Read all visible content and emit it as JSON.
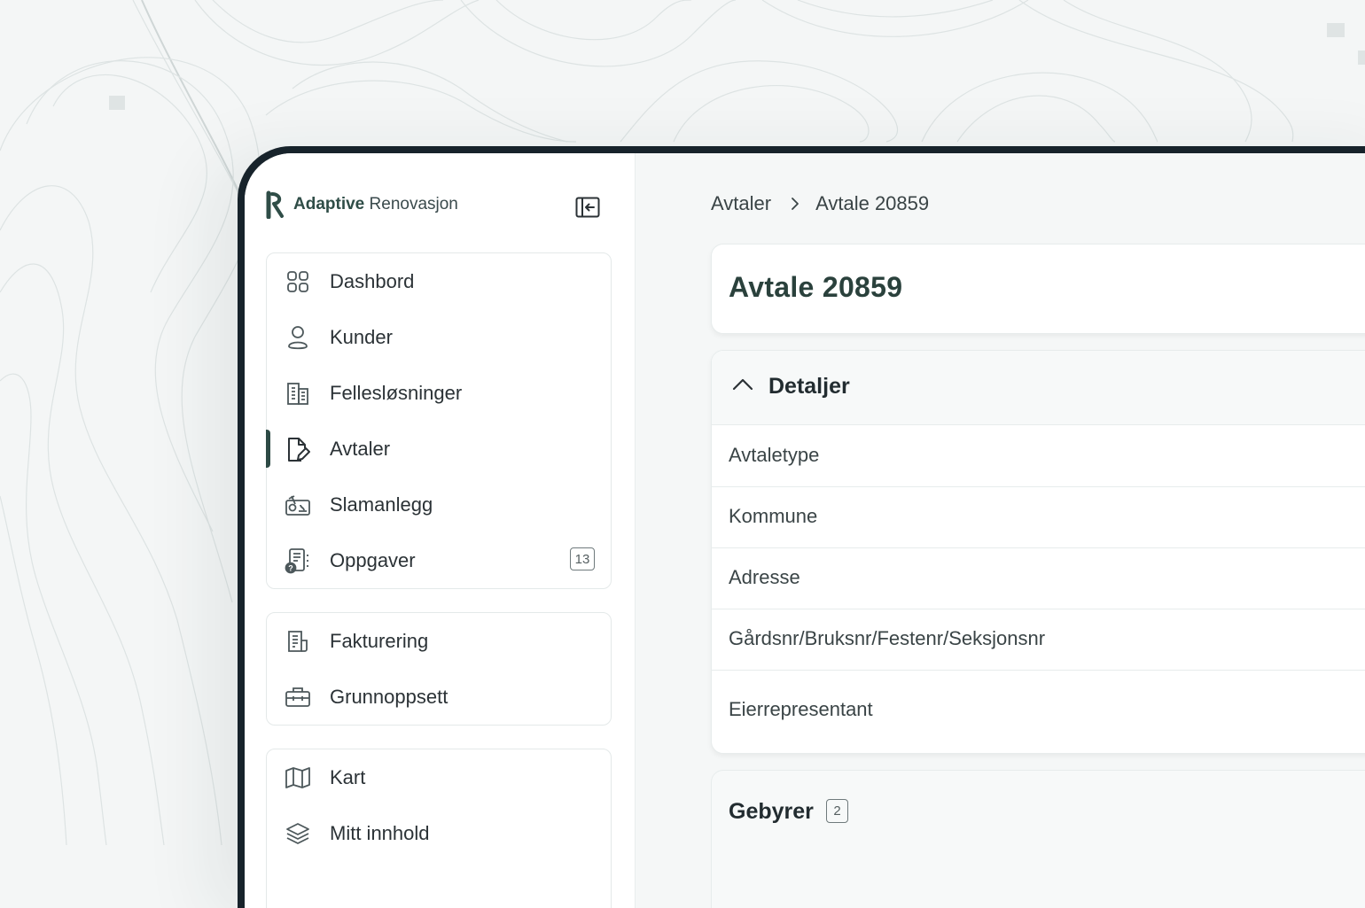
{
  "brand": {
    "name_bold": "Adaptive",
    "name_regular": "Renovasjon",
    "color": "#2f4d47"
  },
  "sidebar": {
    "collapse_icon": "collapse-sidebar-icon",
    "groups": [
      {
        "items": [
          {
            "label": "Dashbord",
            "icon": "dashboard-grid-icon"
          },
          {
            "label": "Kunder",
            "icon": "user-icon"
          },
          {
            "label": "Fellesløsninger",
            "icon": "building-icon"
          },
          {
            "label": "Avtaler",
            "icon": "document-edit-icon",
            "active": true
          },
          {
            "label": "Slamanlegg",
            "icon": "sludge-facility-icon"
          },
          {
            "label": "Oppgaver",
            "icon": "tasks-icon",
            "badge": "13"
          }
        ]
      },
      {
        "items": [
          {
            "label": "Fakturering",
            "icon": "invoice-icon"
          },
          {
            "label": "Grunnoppsett",
            "icon": "briefcase-icon"
          }
        ]
      },
      {
        "items": [
          {
            "label": "Kart",
            "icon": "map-icon"
          },
          {
            "label": "Mitt innhold",
            "icon": "layers-icon"
          }
        ]
      }
    ]
  },
  "breadcrumb": {
    "parent": "Avtaler",
    "current": "Avtale 20859"
  },
  "page": {
    "title": "Avtale 20859"
  },
  "details": {
    "title": "Detaljer",
    "rows": [
      "Avtaletype",
      "Kommune",
      "Adresse",
      "Gårdsnr/Bruksnr/Festenr/Seksjonsnr",
      "Eierrepresentant"
    ]
  },
  "fees": {
    "title": "Gebyrer",
    "count": "2"
  },
  "colors": {
    "accent": "#2d4a45",
    "device_frame": "#17232b",
    "background": "#f4f6f6"
  }
}
